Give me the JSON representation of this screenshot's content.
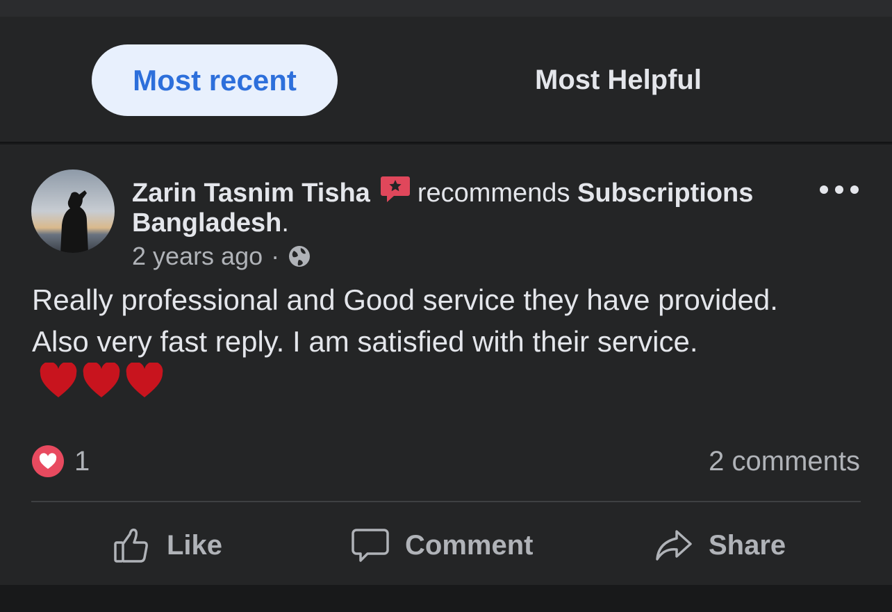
{
  "filter_tabs": {
    "active_label": "Most recent",
    "other_label": "Most Helpful"
  },
  "post": {
    "author": "Zarin Tasnim Tisha",
    "verb": "recommends",
    "page_name": "Subscriptions Bangladesh",
    "period": ".",
    "timestamp": "2 years ago",
    "separator": "·",
    "audience_icon": "globe-icon",
    "badge_icon": "recommendation-star-icon",
    "text": "Really professional and Good service they have provided. Also very fast reply. I am satisfied with their service.",
    "emoji_hearts": 3,
    "reaction_icon": "love-reaction-icon",
    "reaction_count": "1",
    "comments_label": "2 comments",
    "actions": {
      "like": "Like",
      "comment": "Comment",
      "share": "Share"
    }
  },
  "colors": {
    "background": "#242526",
    "accent": "#2d6fdb",
    "badge": "#e0475b",
    "heart": "#c8141e"
  }
}
